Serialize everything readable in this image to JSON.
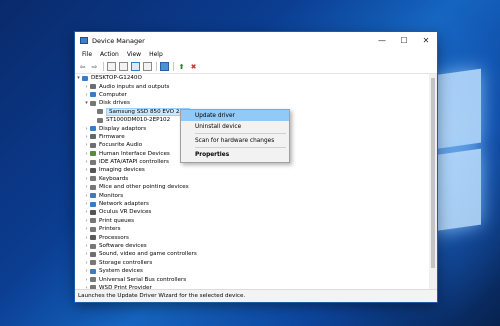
{
  "window": {
    "title": "Device Manager",
    "minimize_glyph": "—",
    "maximize_glyph": "☐",
    "close_glyph": "✕"
  },
  "menubar": [
    "File",
    "Action",
    "View",
    "Help"
  ],
  "toolbar": {
    "back_glyph": "⇦",
    "forward_glyph": "⇨"
  },
  "tree": {
    "root": "DESKTOP-G1240O",
    "items": [
      {
        "label": "Audio inputs and outputs",
        "expanded": false,
        "icon": "speaker-icon",
        "color": "#6e6e6e"
      },
      {
        "label": "Computer",
        "expanded": false,
        "icon": "computer-icon",
        "color": "#3b7bc4"
      },
      {
        "label": "Disk drives",
        "expanded": true,
        "icon": "disk-icon",
        "color": "#777777"
      },
      {
        "label": "Samsung SSD 850 EVO 250",
        "child": true,
        "selected": true,
        "icon": "disk-icon",
        "color": "#777777"
      },
      {
        "label": "ST1000DM010-2EP102",
        "child": true,
        "icon": "disk-icon",
        "color": "#777777"
      },
      {
        "label": "Display adaptors",
        "expanded": false,
        "icon": "monitor-icon",
        "color": "#3b7bc4"
      },
      {
        "label": "Firmware",
        "expanded": false,
        "icon": "chip-icon",
        "color": "#666666"
      },
      {
        "label": "Focusrite Audio",
        "expanded": false,
        "icon": "speaker-icon",
        "color": "#6e6e6e"
      },
      {
        "label": "Human Interface Devices",
        "expanded": false,
        "icon": "hid-icon",
        "color": "#5a8a3a"
      },
      {
        "label": "IDE ATA/ATAPI controllers",
        "expanded": false,
        "icon": "controller-icon",
        "color": "#777777"
      },
      {
        "label": "Imaging devices",
        "expanded": false,
        "icon": "camera-icon",
        "color": "#555555"
      },
      {
        "label": "Keyboards",
        "expanded": false,
        "icon": "keyboard-icon",
        "color": "#777777"
      },
      {
        "label": "Mice and other pointing devices",
        "expanded": false,
        "icon": "mouse-icon",
        "color": "#777777"
      },
      {
        "label": "Monitors",
        "expanded": false,
        "icon": "monitor-icon",
        "color": "#3b7bc4"
      },
      {
        "label": "Network adapters",
        "expanded": false,
        "icon": "network-icon",
        "color": "#3b7bc4"
      },
      {
        "label": "Oculus VR Devices",
        "expanded": false,
        "icon": "vr-icon",
        "color": "#555555"
      },
      {
        "label": "Print queues",
        "expanded": false,
        "icon": "printer-icon",
        "color": "#777777"
      },
      {
        "label": "Printers",
        "expanded": false,
        "icon": "printer-icon",
        "color": "#777777"
      },
      {
        "label": "Processors",
        "expanded": false,
        "icon": "cpu-icon",
        "color": "#5a5a5a"
      },
      {
        "label": "Software devices",
        "expanded": false,
        "icon": "software-icon",
        "color": "#777777"
      },
      {
        "label": "Sound, video and game controllers",
        "expanded": false,
        "icon": "speaker-icon",
        "color": "#6e6e6e"
      },
      {
        "label": "Storage controllers",
        "expanded": false,
        "icon": "controller-icon",
        "color": "#777777"
      },
      {
        "label": "System devices",
        "expanded": false,
        "icon": "system-icon",
        "color": "#3b7bc4"
      },
      {
        "label": "Universal Serial Bus controllers",
        "expanded": false,
        "icon": "usb-icon",
        "color": "#777777"
      },
      {
        "label": "WSD Print Provider",
        "expanded": false,
        "icon": "printer-icon",
        "color": "#777777"
      }
    ]
  },
  "context_menu": {
    "update_driver": "Update driver",
    "uninstall_device": "Uninstall device",
    "scan_hardware": "Scan for hardware changes",
    "properties": "Properties"
  },
  "statusbar": "Launches the Update Driver Wizard for the selected device.",
  "colors": {
    "selection": "#cce8ff",
    "menu_highlight": "#91c9f7",
    "desktop": "#0b3d91"
  }
}
